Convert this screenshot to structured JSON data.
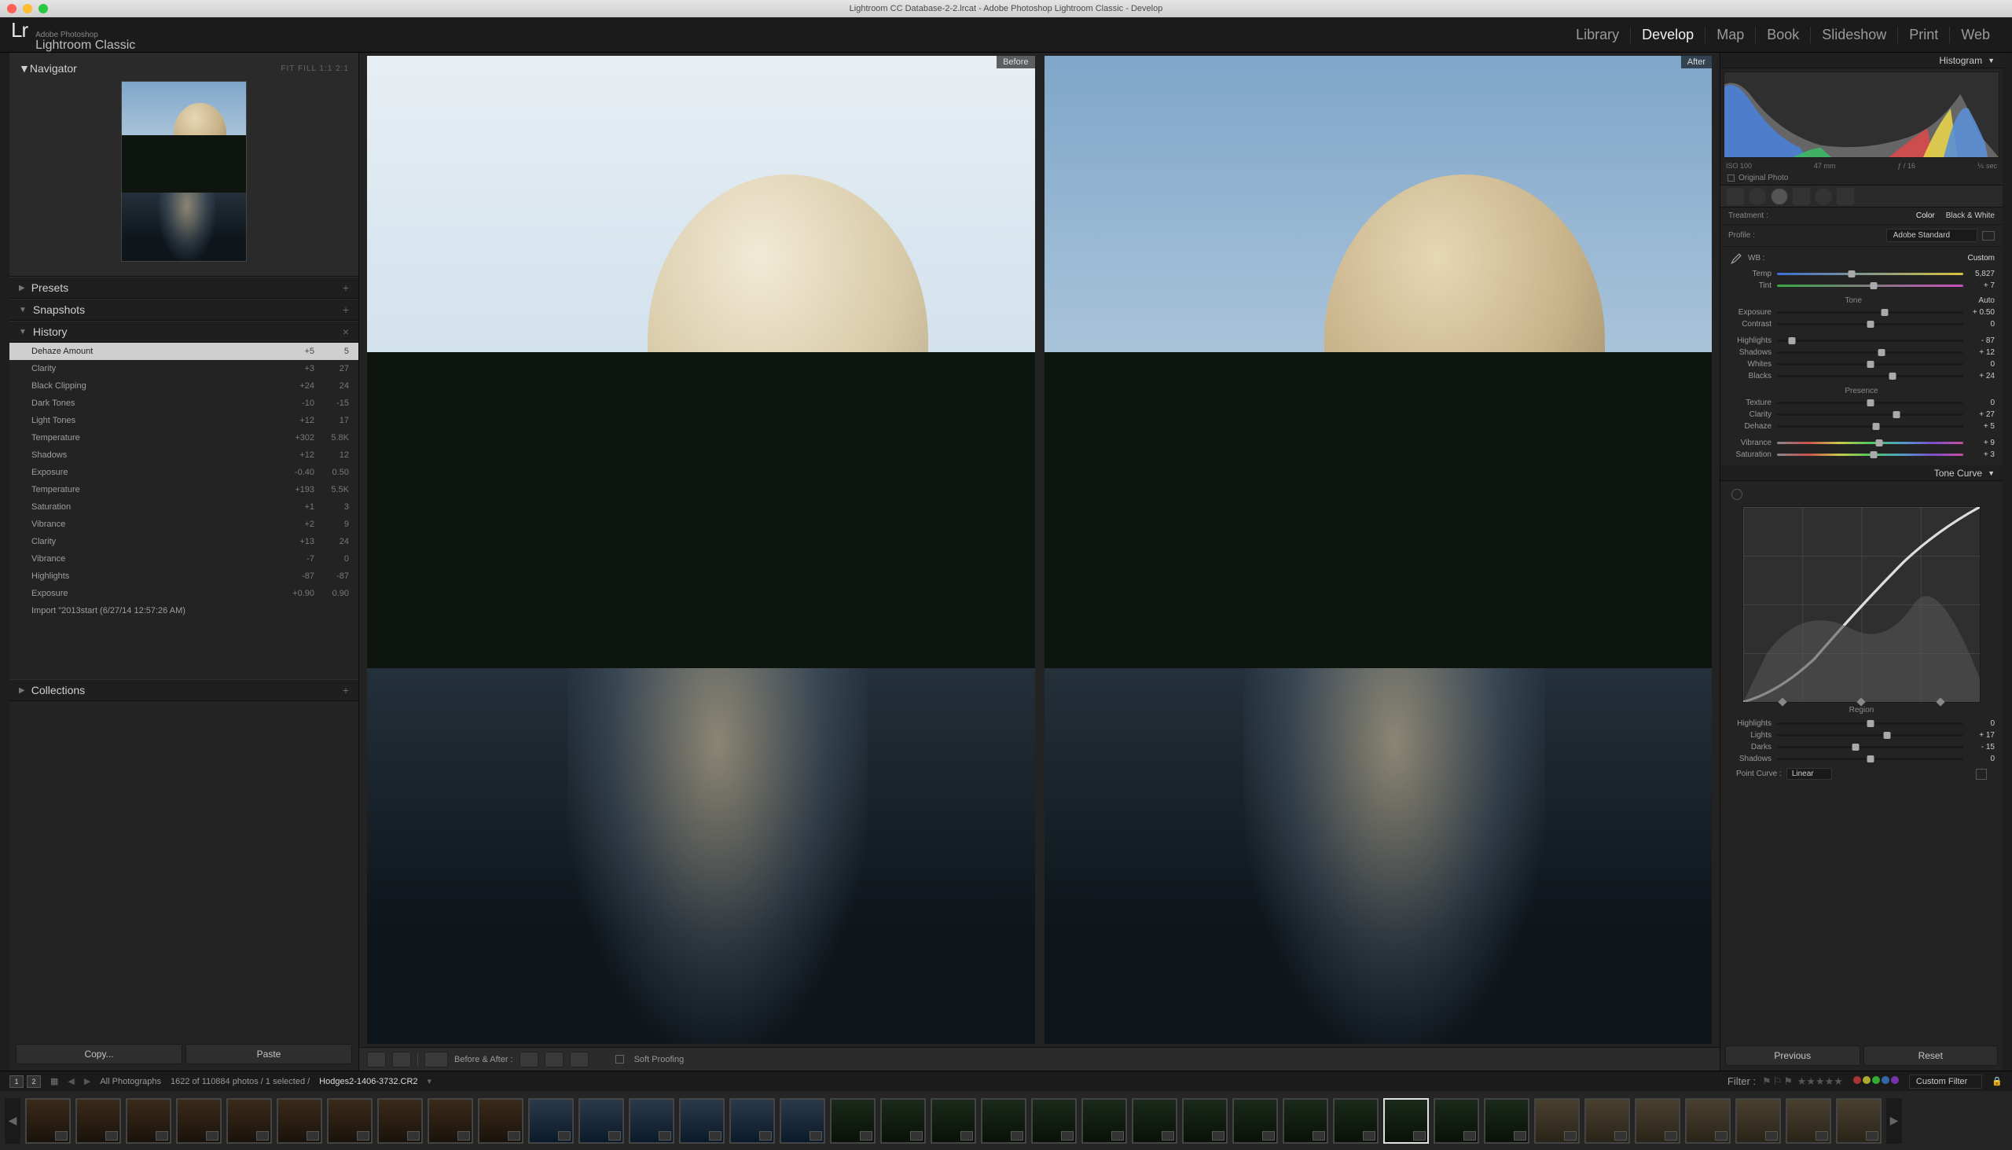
{
  "window_title": "Lightroom CC Database-2-2.lrcat - Adobe Photoshop Lightroom Classic - Develop",
  "app": {
    "tagline_small": "Adobe Photoshop",
    "tagline_big": "Lightroom Classic"
  },
  "modules": [
    "Library",
    "Develop",
    "Map",
    "Book",
    "Slideshow",
    "Print",
    "Web"
  ],
  "active_module": "Develop",
  "left": {
    "navigator": {
      "label": "Navigator",
      "zoom": "FIT   FILL   1:1   2:1"
    },
    "presets": "Presets",
    "snapshots": "Snapshots",
    "history": {
      "label": "History",
      "items": [
        {
          "name": "Dehaze Amount",
          "v1": "+5",
          "v2": "5",
          "sel": true
        },
        {
          "name": "Clarity",
          "v1": "+3",
          "v2": "27"
        },
        {
          "name": "Black Clipping",
          "v1": "+24",
          "v2": "24"
        },
        {
          "name": "Dark Tones",
          "v1": "-10",
          "v2": "-15"
        },
        {
          "name": "Light Tones",
          "v1": "+12",
          "v2": "17"
        },
        {
          "name": "Temperature",
          "v1": "+302",
          "v2": "5.8K"
        },
        {
          "name": "Shadows",
          "v1": "+12",
          "v2": "12"
        },
        {
          "name": "Exposure",
          "v1": "-0.40",
          "v2": "0.50"
        },
        {
          "name": "Temperature",
          "v1": "+193",
          "v2": "5.5K"
        },
        {
          "name": "Saturation",
          "v1": "+1",
          "v2": "3"
        },
        {
          "name": "Vibrance",
          "v1": "+2",
          "v2": "9"
        },
        {
          "name": "Clarity",
          "v1": "+13",
          "v2": "24"
        },
        {
          "name": "Vibrance",
          "v1": "-7",
          "v2": "0"
        },
        {
          "name": "Highlights",
          "v1": "-87",
          "v2": "-87"
        },
        {
          "name": "Exposure",
          "v1": "+0.90",
          "v2": "0.90"
        },
        {
          "name": "Import \"2013start (6/27/14 12:57:26 AM)",
          "v1": "",
          "v2": ""
        }
      ]
    },
    "collections": "Collections",
    "copy": "Copy...",
    "paste": "Paste"
  },
  "center": {
    "before": "Before",
    "after": "After",
    "toolbar": {
      "ba_label": "Before & After :",
      "soft": "Soft Proofing"
    }
  },
  "right": {
    "histogram": "Histogram",
    "histo_meta": {
      "iso": "ISO 100",
      "mm": "47 mm",
      "f": "ƒ / 16",
      "s": "⅙ sec"
    },
    "original": "Original Photo",
    "treatment": {
      "label": "Treatment :",
      "color": "Color",
      "bw": "Black & White"
    },
    "profile": {
      "label": "Profile :",
      "value": "Adobe Standard"
    },
    "wb": {
      "label": "WB :",
      "value": "Custom",
      "temp": {
        "l": "Temp",
        "v": "5,827"
      },
      "tint": {
        "l": "Tint",
        "v": "+ 7"
      }
    },
    "tone": {
      "header": "Tone",
      "auto": "Auto",
      "rows": [
        {
          "l": "Exposure",
          "v": "+ 0.50",
          "p": 58
        },
        {
          "l": "Contrast",
          "v": "0",
          "p": 50
        }
      ]
    },
    "tone2": [
      {
        "l": "Highlights",
        "v": "- 87",
        "p": 8
      },
      {
        "l": "Shadows",
        "v": "+ 12",
        "p": 56
      },
      {
        "l": "Whites",
        "v": "0",
        "p": 50
      },
      {
        "l": "Blacks",
        "v": "+ 24",
        "p": 62
      }
    ],
    "presence": {
      "header": "Presence",
      "rows": [
        {
          "l": "Texture",
          "v": "0",
          "p": 50
        },
        {
          "l": "Clarity",
          "v": "+ 27",
          "p": 64
        },
        {
          "l": "Dehaze",
          "v": "+ 5",
          "p": 53
        }
      ]
    },
    "presence2": [
      {
        "l": "Vibrance",
        "v": "+ 9",
        "p": 55,
        "c": "vib"
      },
      {
        "l": "Saturation",
        "v": "+ 3",
        "p": 52,
        "c": "vib"
      }
    ],
    "tonecurve": "Tone Curve",
    "region": {
      "header": "Region",
      "rows": [
        {
          "l": "Highlights",
          "v": "0",
          "p": 50
        },
        {
          "l": "Lights",
          "v": "+ 17",
          "p": 59
        },
        {
          "l": "Darks",
          "v": "- 15",
          "p": 42
        },
        {
          "l": "Shadows",
          "v": "0",
          "p": 50
        }
      ]
    },
    "pointcurve": {
      "label": "Point Curve :",
      "value": "Linear"
    },
    "previous": "Previous",
    "reset": "Reset"
  },
  "infobar": {
    "all": "All Photographs",
    "count": "1622 of 110884 photos / 1 selected /",
    "file": "Hodges2-1406-3732.CR2",
    "filter": "Filter :",
    "custom": "Custom Filter"
  }
}
